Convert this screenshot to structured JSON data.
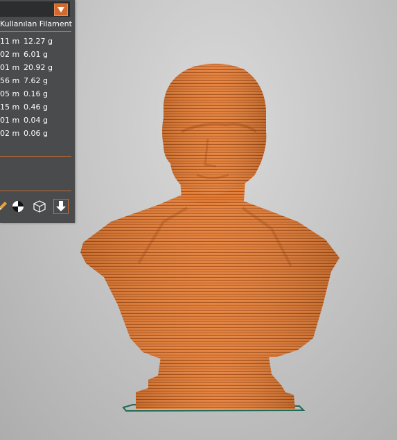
{
  "panel": {
    "header": "Kullanılan Filament",
    "rows": [
      {
        "length": "11 m",
        "weight": "12.27 g"
      },
      {
        "length": "02 m",
        "weight": "6.01 g"
      },
      {
        "length": "01 m",
        "weight": "20.92 g"
      },
      {
        "length": "56 m",
        "weight": "7.62 g"
      },
      {
        "length": "05 m",
        "weight": "0.16 g"
      },
      {
        "length": "15 m",
        "weight": "0.46 g"
      },
      {
        "length": "01 m",
        "weight": "0.04 g"
      },
      {
        "length": "02 m",
        "weight": "0.06 g"
      }
    ],
    "toolbar_icons": [
      "pencil-icon",
      "color-scheme-icon",
      "wireframe-cube-icon",
      "download-arrow-icon"
    ]
  },
  "colors": {
    "accent": "#d26a2d",
    "panel_bg": "#4a4b4d",
    "model": "#e07a33",
    "build_plate": "#1f6a55"
  }
}
